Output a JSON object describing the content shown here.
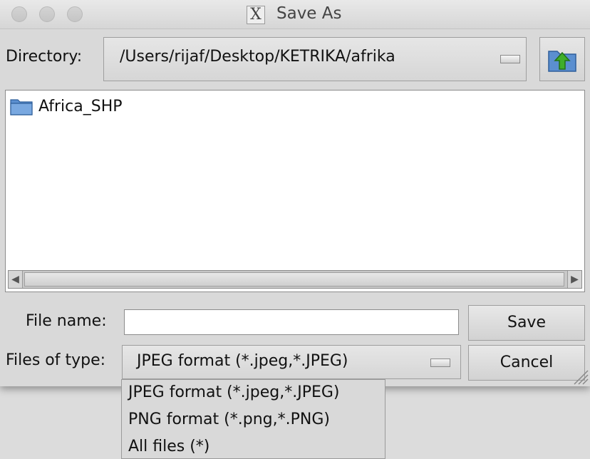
{
  "window": {
    "title": "Save As"
  },
  "directory": {
    "label": "Directory:",
    "value": "/Users/rijaf/Desktop/KETRIKA/afrika"
  },
  "file_list": {
    "items": [
      {
        "name": "Africa_SHP",
        "icon": "folder-icon"
      }
    ]
  },
  "file_name": {
    "label": "File name:",
    "value": ""
  },
  "files_of_type": {
    "label": "Files of type:",
    "selected": "JPEG format (*.jpeg,*.JPEG)",
    "options": [
      "JPEG format (*.jpeg,*.JPEG)",
      "PNG format (*.png,*.PNG)",
      "All files (*)"
    ]
  },
  "buttons": {
    "save": "Save",
    "cancel": "Cancel"
  },
  "colors": {
    "folder": "#5b8fd0",
    "up_arrow": "#3fae2a"
  }
}
